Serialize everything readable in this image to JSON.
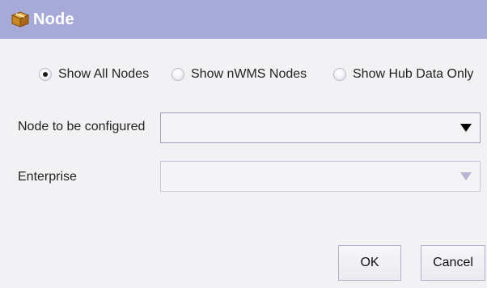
{
  "window": {
    "title": "Node",
    "icon": "box-package-icon"
  },
  "radios": [
    {
      "label": "Show All Nodes",
      "checked": true
    },
    {
      "label": "Show nWMS Nodes",
      "checked": false
    },
    {
      "label": "Show Hub Data Only",
      "checked": false
    }
  ],
  "fields": {
    "node": {
      "label": "Node to be configured",
      "value": "",
      "enabled": true
    },
    "enterprise": {
      "label": "Enterprise",
      "value": "",
      "enabled": false
    }
  },
  "buttons": {
    "ok": "OK",
    "cancel": "Cancel"
  },
  "colors": {
    "titlebar": "#a7a9d6",
    "background": "#f2f2f5",
    "disabled_arrow": "#b3b5d2"
  }
}
